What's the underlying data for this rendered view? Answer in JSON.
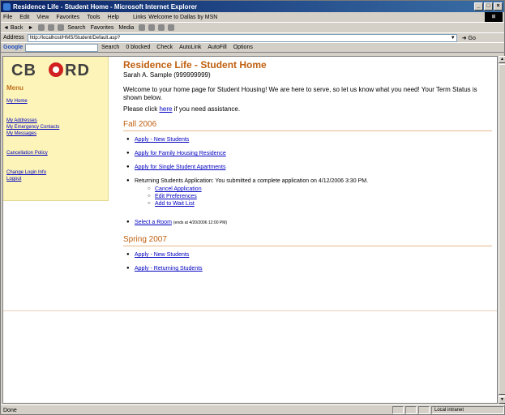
{
  "window": {
    "title": "Residence Life - Student Home - Microsoft Internet Explorer",
    "buttons": [
      "_",
      "□",
      "×"
    ]
  },
  "menubar": {
    "items": [
      "File",
      "Edit",
      "View",
      "Favorites",
      "Tools",
      "Help"
    ],
    "links_label": "Links",
    "links_item": "Welcome to Dallas by MSN"
  },
  "toolbar": {
    "items": [
      "Back",
      "Search",
      "Favorites",
      "Media"
    ]
  },
  "address": {
    "label": "Address",
    "url": "http://localhost/HMS/Student/Default.asp?",
    "go": "Go"
  },
  "googlebar": {
    "logo": "Google",
    "items": [
      "Search",
      "0 blocked",
      "Check",
      "AutoLink",
      "AutoFill",
      "Options"
    ]
  },
  "status": {
    "text": "Done",
    "zone": "Local intranet"
  },
  "sidebar": {
    "logo_text": "CBORD",
    "menu_title": "Menu",
    "links_group1": [
      "My Home"
    ],
    "links_group2": [
      "My Addresses",
      "My Emergency Contacts",
      "My Messages"
    ],
    "links_group3": [
      "Cancellation Policy"
    ],
    "links_group4": [
      "Change Login Info",
      "Logout"
    ]
  },
  "content": {
    "title": "Residence Life - Student Home",
    "student": "Sarah A. Sample (999999999)",
    "welcome": "Welcome to your home page for Student Housing! We are here to serve, so let us know what you need! Your Term Status is shown below.",
    "assist_prefix": "Please click ",
    "assist_link": "here",
    "assist_suffix": " if you need assistance.",
    "terms": [
      {
        "name": "Fall 2006",
        "options": [
          {
            "link": "Apply - New Students"
          },
          {
            "link": "Apply for Family Housing Residence"
          },
          {
            "link": "Apply for Single Student Apartments"
          },
          {
            "text": "Returning Students Application: You submitted a complete application on 4/12/2006 3:30 PM.",
            "sub": [
              "Cancel Application",
              "Edit Preferences",
              "Add to Wait List"
            ]
          },
          {
            "link": "Select a Room",
            "note": "(ends at 4/20/2006 12:00 PM)"
          }
        ]
      },
      {
        "name": "Spring 2007",
        "options": [
          {
            "link": "Apply - New Students"
          },
          {
            "link": "Apply - Returning Students"
          }
        ]
      }
    ]
  }
}
